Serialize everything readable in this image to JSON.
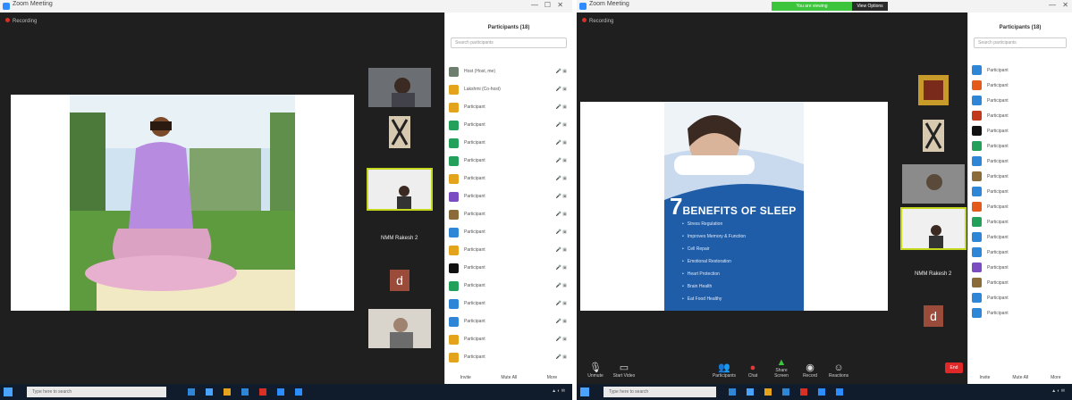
{
  "left": {
    "app_title": "Zoom Meeting",
    "recording": "Recording",
    "panel_title": "Participants (18)",
    "search_placeholder": "Search participants",
    "thumbnail_name": "NMM Rakesh 2",
    "footer": [
      "Invite",
      "Mute All",
      "More"
    ],
    "participants": [
      {
        "name": "Host (Host, me)",
        "color": "#6f7f6f",
        "icons": "🎤 ▣"
      },
      {
        "name": "Lakshmi (Co-host)",
        "color": "#e3a31a",
        "icons": "🎤 ▣"
      },
      {
        "name": "Participant",
        "color": "#e3a31a",
        "icons": "🎤 ▣"
      },
      {
        "name": "Participant",
        "color": "#23a05a",
        "icons": "🎤 ▣"
      },
      {
        "name": "Participant",
        "color": "#23a05a",
        "icons": "🎤 ▣"
      },
      {
        "name": "Participant",
        "color": "#23a05a",
        "icons": "🎤 ▣"
      },
      {
        "name": "Participant",
        "color": "#e3a31a",
        "icons": "🎤 ▣"
      },
      {
        "name": "Participant",
        "color": "#7b4bc2",
        "icons": "🎤 ▣"
      },
      {
        "name": "Participant",
        "color": "#8c6b3a",
        "icons": "🎤 ▣"
      },
      {
        "name": "Participant",
        "color": "#2f86d6",
        "icons": "🎤 ▣"
      },
      {
        "name": "Participant",
        "color": "#e3a31a",
        "icons": "🎤 ▣"
      },
      {
        "name": "Participant",
        "color": "#111111",
        "icons": "🎤 ▣"
      },
      {
        "name": "Participant",
        "color": "#23a05a",
        "icons": "🎤 ▣"
      },
      {
        "name": "Participant",
        "color": "#2f86d6",
        "icons": "🎤 ▣"
      },
      {
        "name": "Participant",
        "color": "#2f86d6",
        "icons": "🎤 ▣"
      },
      {
        "name": "Participant",
        "color": "#e3a31a",
        "icons": "🎤 ▣"
      },
      {
        "name": "Participant",
        "color": "#e3a31a",
        "icons": "🎤 ▣"
      }
    ],
    "taskbar_search": "Type here to search"
  },
  "right": {
    "app_title": "Zoom Meeting",
    "recording": "Recording",
    "banner_view": "You are viewing",
    "banner_options": "View Options",
    "panel_title": "Participants (18)",
    "search_placeholder": "Search participants",
    "thumbnail_name": "NMM Rakesh 2",
    "slide": {
      "big": "7",
      "rest": "BENEFITS OF SLEEP",
      "items": [
        "Stress Regulation",
        "Improves Memory & Function",
        "Cell Repair",
        "Emotional Restoration",
        "Heart Protection",
        "Brain Health",
        "Eat Food Healthy"
      ]
    },
    "controls": [
      "Unmute",
      "Start Video",
      "Participants",
      "Chat",
      "Share Screen",
      "Record",
      "Reactions"
    ],
    "end_label": "End",
    "footer": [
      "Invite",
      "Mute All",
      "More"
    ],
    "participants": [
      {
        "name": "Participant",
        "color": "#2f86d6"
      },
      {
        "name": "Participant",
        "color": "#e35a1a"
      },
      {
        "name": "Participant",
        "color": "#2f86d6"
      },
      {
        "name": "Participant",
        "color": "#c2391b"
      },
      {
        "name": "Participant",
        "color": "#111111"
      },
      {
        "name": "Participant",
        "color": "#23a05a"
      },
      {
        "name": "Participant",
        "color": "#2f86d6"
      },
      {
        "name": "Participant",
        "color": "#8c6b3a"
      },
      {
        "name": "Participant",
        "color": "#2f86d6"
      },
      {
        "name": "Participant",
        "color": "#e35a1a"
      },
      {
        "name": "Participant",
        "color": "#23a05a"
      },
      {
        "name": "Participant",
        "color": "#2f86d6"
      },
      {
        "name": "Participant",
        "color": "#2f86d6"
      },
      {
        "name": "Participant",
        "color": "#7b4bc2"
      },
      {
        "name": "Participant",
        "color": "#8c6b3a"
      },
      {
        "name": "Participant",
        "color": "#2f86d6"
      },
      {
        "name": "Participant",
        "color": "#2f86d6"
      }
    ],
    "taskbar_search": "Type here to search"
  }
}
